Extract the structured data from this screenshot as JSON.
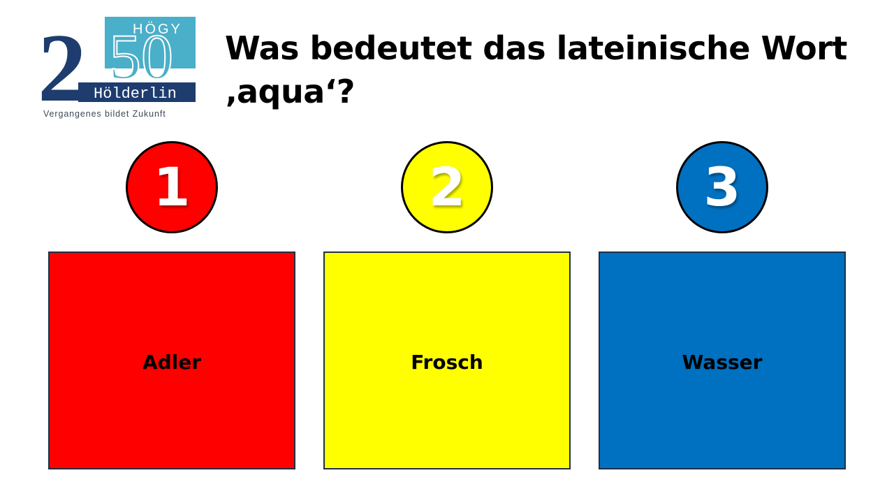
{
  "logo": {
    "number": "250",
    "top_text": "HÖGY",
    "name_text": "Hölderlin",
    "tagline": "Vergangenes bildet Zukunft",
    "colors": {
      "navy": "#1e3c6e",
      "teal": "#4aafc8"
    }
  },
  "question": {
    "line1": "Was bedeutet das lateinische Wort",
    "line2": "‚aqua‘?"
  },
  "options": [
    {
      "number": "1",
      "label": "Adler",
      "color": "#ff0000"
    },
    {
      "number": "2",
      "label": "Frosch",
      "color": "#ffff00"
    },
    {
      "number": "3",
      "label": "Wasser",
      "color": "#0070c0"
    }
  ]
}
